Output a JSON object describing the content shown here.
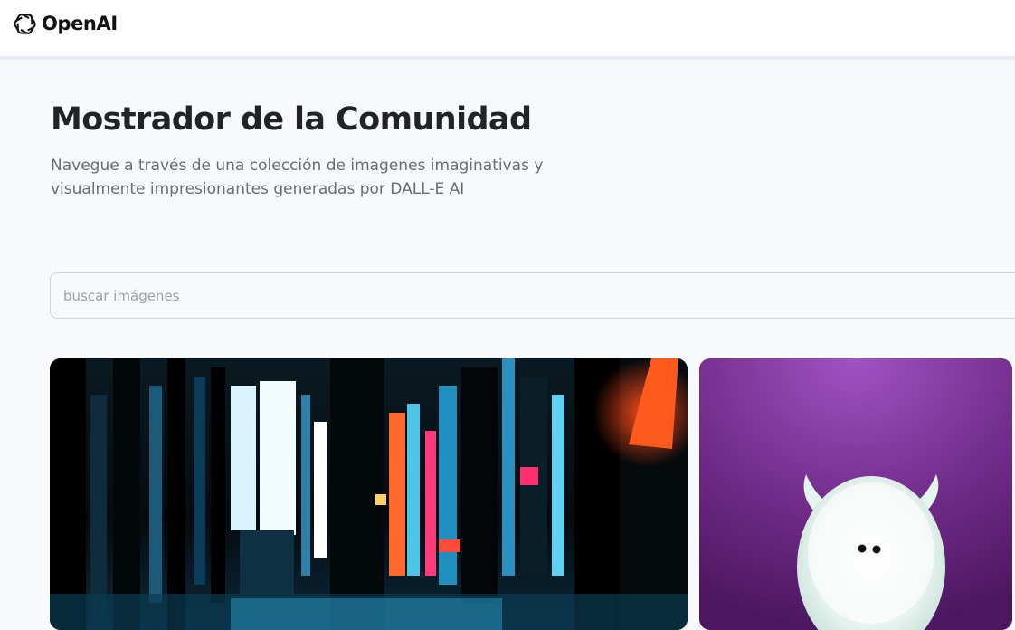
{
  "header": {
    "logo_text": "OpenAI",
    "logo_icon": "openai-logo-icon"
  },
  "hero": {
    "title": "Mostrador de la Comunidad",
    "subtitle": "Navegue a través de una colección de imagenes imaginativas y visualmente impresionantes generadas por DALL-E AI"
  },
  "search": {
    "placeholder": "buscar imágenes",
    "value": ""
  },
  "gallery": {
    "items": [
      {
        "kind": "image",
        "subject": "neon city street at night"
      },
      {
        "kind": "image",
        "subject": "white fluffy horned creature on purple background"
      }
    ]
  },
  "colors": {
    "background": "#f8f9fb",
    "header_bg": "#ffffff",
    "title": "#222328",
    "subtitle": "#666e75",
    "search_border": "#d0d4d9"
  }
}
